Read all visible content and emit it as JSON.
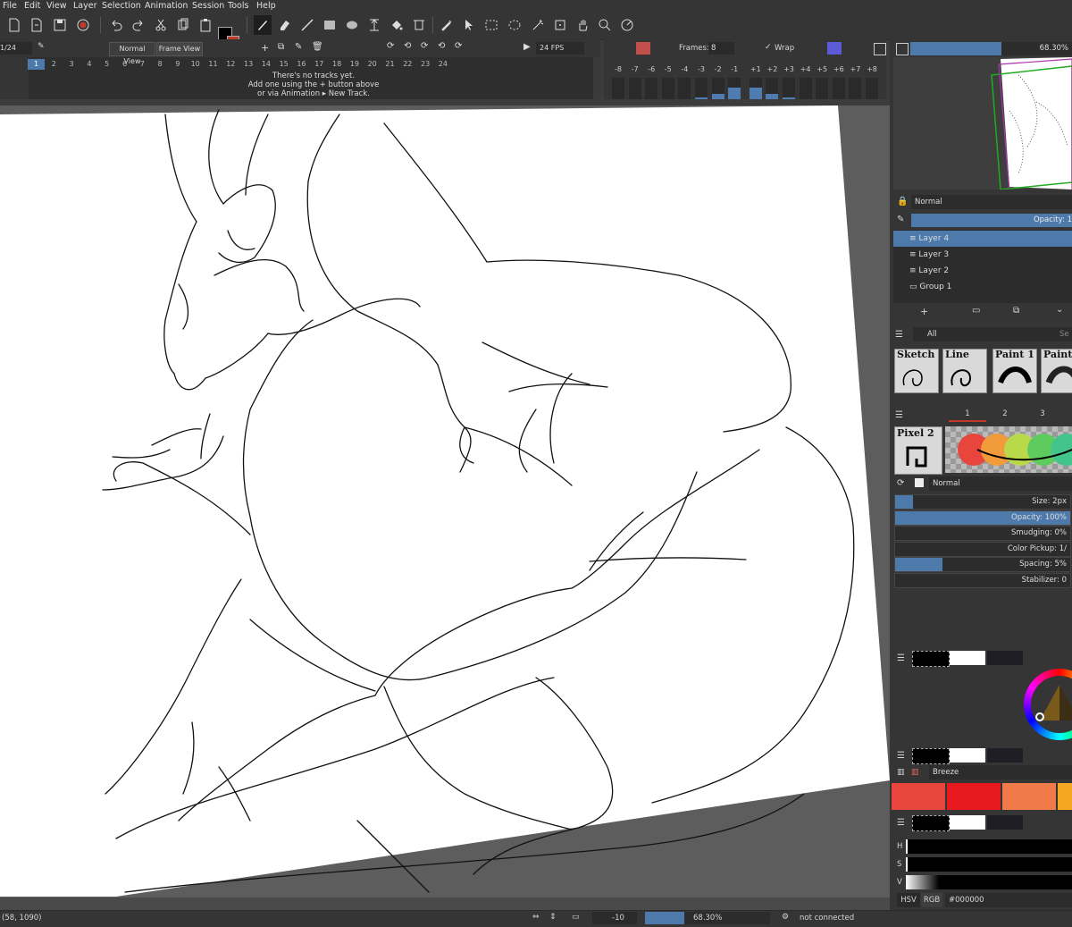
{
  "menu": [
    "File",
    "Edit",
    "View",
    "Layer",
    "Selection",
    "Animation",
    "Session",
    "Tools",
    "Help"
  ],
  "timeline": {
    "frame_counter": "1/24",
    "view_tabs": [
      "Normal View",
      "Frame View"
    ],
    "frame_numbers": [
      "1",
      "2",
      "3",
      "4",
      "5",
      "6",
      "7",
      "8",
      "9",
      "10",
      "11",
      "12",
      "13",
      "14",
      "15",
      "16",
      "17",
      "18",
      "19",
      "20",
      "21",
      "22",
      "23",
      "24"
    ],
    "message_line1": "There's no tracks yet.",
    "message_line2": "Add one using the  +  button above",
    "message_line3": "or via Animation ▸ New Track.",
    "fps": "24 FPS",
    "frames_label": "Frames:",
    "frames_value": "8",
    "wrap_label": "Wrap",
    "wrap_checked": "✓"
  },
  "onion_skin": {
    "labels": [
      "-8",
      "-7",
      "-6",
      "-5",
      "-4",
      "-3",
      "-2",
      "-1",
      "+1",
      "+2",
      "+3",
      "+4",
      "+5",
      "+6",
      "+7",
      "+8"
    ],
    "levels": [
      0,
      0,
      0,
      0,
      0,
      0.1,
      0.25,
      0.55,
      0.55,
      0.25,
      0.1,
      0,
      0,
      0,
      0,
      0
    ]
  },
  "navigator": {
    "zoom": "68.30%"
  },
  "layers": {
    "blend_mode": "Normal",
    "opacity_label": "Opacity: 1",
    "items": [
      "Layer 4",
      "Layer 3",
      "Layer 2",
      "Group 1"
    ],
    "selected": "Layer 4"
  },
  "brushes": {
    "tag": "All",
    "search_placeholder": "Se",
    "presets": [
      "Sketch",
      "Line",
      "Paint 1",
      "Paint"
    ],
    "tabs": [
      "1",
      "2",
      "3"
    ],
    "current": "Pixel 2"
  },
  "brush_settings": {
    "blend_mode": "Normal",
    "size": "Size: 2px",
    "opacity": "Opacity: 100%",
    "smudging": "Smudging: 0%",
    "color_pickup": "Color Pickup: 1/",
    "spacing": "Spacing: 5%",
    "stabilizer": "Stabilizer: 0"
  },
  "palette": {
    "name": "Breeze",
    "colors": [
      "#e8463c",
      "#e8191e",
      "#f07a4a",
      "#f5a623"
    ]
  },
  "color": {
    "tabs": [
      "HSV",
      "RGB"
    ],
    "hex": "#000000",
    "channels": [
      "H",
      "S",
      "V"
    ]
  },
  "status": {
    "coords": "(58, 1090)",
    "rotation": "-10",
    "zoom": "68.30%",
    "connection": "not connected"
  },
  "colors": {
    "accent": "#4d7aab",
    "canvas_bg": "#5d5d5d",
    "panel": "#353535"
  }
}
